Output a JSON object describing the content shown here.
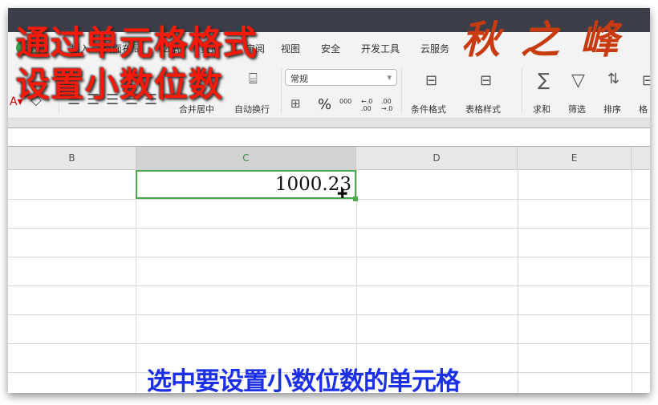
{
  "tabs": [
    "开始",
    "插入",
    "页面布局",
    "公式",
    "数据",
    "审阅",
    "视图",
    "安全",
    "开发工具",
    "云服务"
  ],
  "ribbon": {
    "merge_center": "合并居中",
    "wrap_text": "自动换行",
    "number_format": "常规",
    "percent": "%",
    "thousands": "000",
    "inc_decimal": "←.0 .00",
    "dec_decimal": ".00 →.0",
    "conditional_format": "条件格式",
    "table_style": "表格样式",
    "sum": "求和",
    "filter": "筛选",
    "sort": "排序",
    "format": "格"
  },
  "columns": [
    "B",
    "C",
    "D",
    "E"
  ],
  "cell_value": "1000.23",
  "overlay": {
    "title_line1": "通过单元格格式",
    "title_line2": "设置小数位数",
    "caption": "选中要设置小数位数的单元格",
    "logo": "秋之峰"
  }
}
